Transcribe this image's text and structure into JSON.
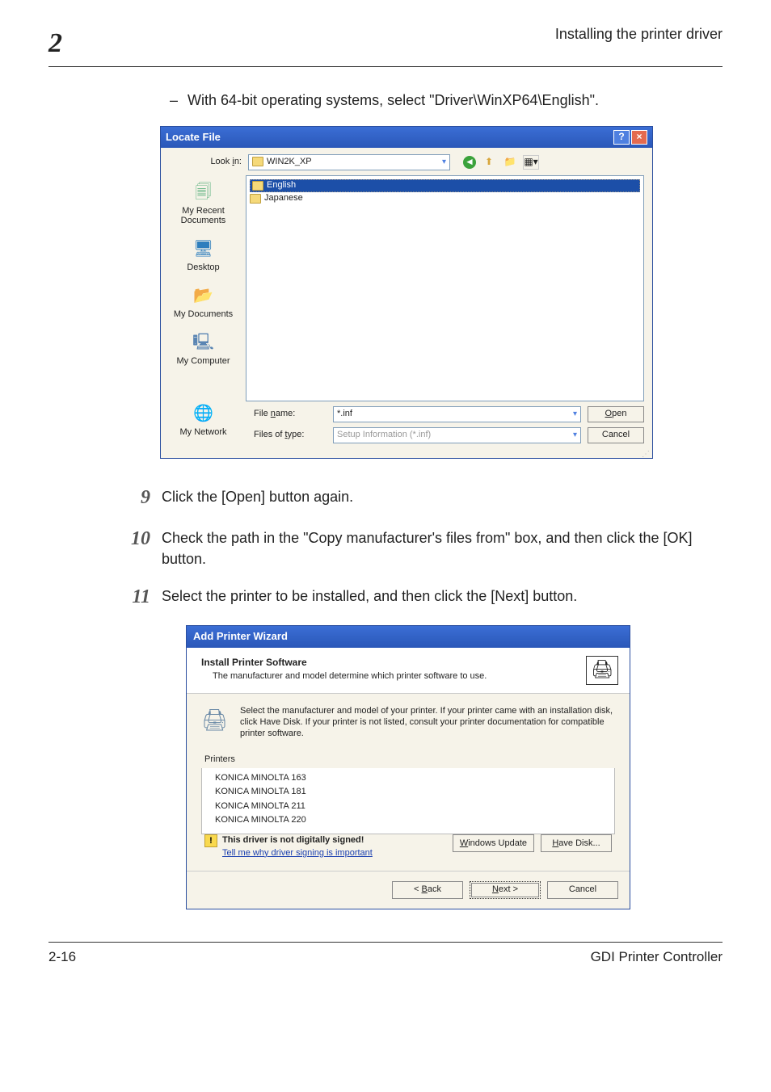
{
  "header": {
    "chapter": "2",
    "title": "Installing the printer driver"
  },
  "intro_item": "With 64-bit operating systems, select \"Driver\\WinXP64\\English\".",
  "locate": {
    "title": "Locate File",
    "lookin_label": "Look in:",
    "lookin_value": "WIN2K_XP",
    "places": {
      "recent": "My Recent Documents",
      "desktop": "Desktop",
      "mydocs": "My Documents",
      "mycomp": "My Computer",
      "mynet": "My Network"
    },
    "folders": [
      "English",
      "Japanese"
    ],
    "filename_label": "File name:",
    "filename_value": "*.inf",
    "filetype_label": "Files of type:",
    "filetype_value": "Setup Information (*.inf)",
    "open_btn": "Open",
    "cancel_btn": "Cancel"
  },
  "steps": {
    "s9_num": "9",
    "s9_text": "Click the [Open] button again.",
    "s10_num": "10",
    "s10_text": "Check the path in the \"Copy manufacturer's files from\" box, and then click the [OK] button.",
    "s11_num": "11",
    "s11_text": "Select the printer to be installed, and then click the [Next] button."
  },
  "wizard": {
    "title": "Add Printer Wizard",
    "heading": "Install Printer Software",
    "subheading": "The manufacturer and model determine which printer software to use.",
    "info": "Select the manufacturer and model of your printer. If your printer came with an installation disk, click Have Disk. If your printer is not listed, consult your printer documentation for compatible printer software.",
    "printers_label": "Printers",
    "printers": [
      "KONICA MINOLTA 163",
      "KONICA MINOLTA 181",
      "KONICA MINOLTA 211",
      "KONICA MINOLTA 220"
    ],
    "signed_warning": "This driver is not digitally signed!",
    "signed_link": "Tell me why driver signing is important",
    "windows_update": "Windows Update",
    "have_disk": "Have Disk...",
    "back": "< Back",
    "next": "Next >",
    "cancel": "Cancel"
  },
  "footer": {
    "page": "2-16",
    "doc": "GDI Printer Controller"
  }
}
